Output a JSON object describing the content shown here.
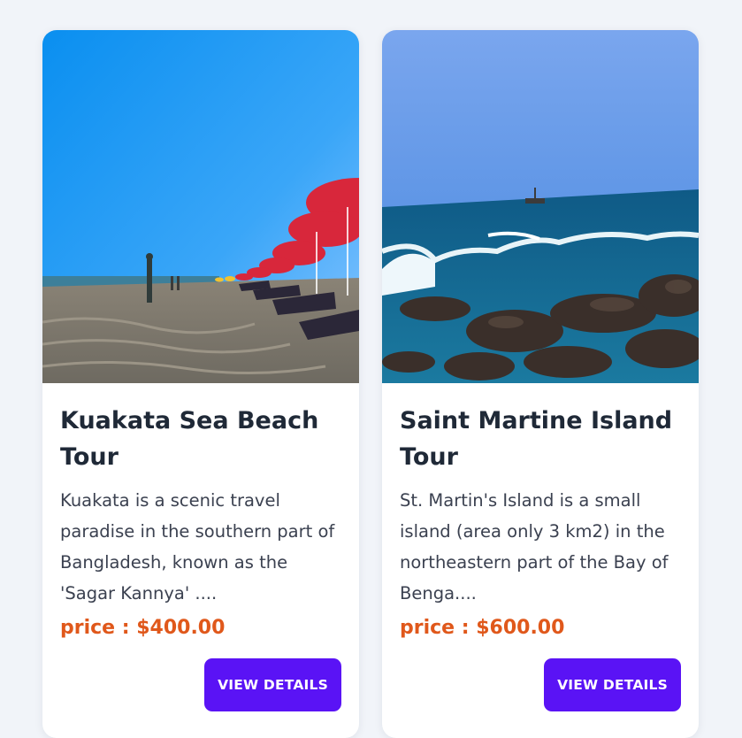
{
  "tours": [
    {
      "image_alt": "Kuakata sea beach with red umbrellas",
      "title": "Kuakata Sea Beach Tour",
      "description": "Kuakata is a scenic travel paradise in the southern part of Bangladesh, known as the 'Sagar Kannya' ....",
      "price": "price : $400.00",
      "button_label": "VIEW DETAILS"
    },
    {
      "image_alt": "Saint Martin island rocky shore with boat",
      "title": "Saint Martine Island Tour",
      "description": "St. Martin's Island is a small island (area only 3 km2) in the northeastern part of the Bay of Benga....",
      "price": "price : $600.00",
      "button_label": "VIEW DETAILS"
    }
  ],
  "colors": {
    "background": "#f1f4f9",
    "card": "#ffffff",
    "title": "#1f2937",
    "text": "#3b4150",
    "price": "#e0581b",
    "button": "#5a13f5",
    "button_text": "#ffffff"
  }
}
